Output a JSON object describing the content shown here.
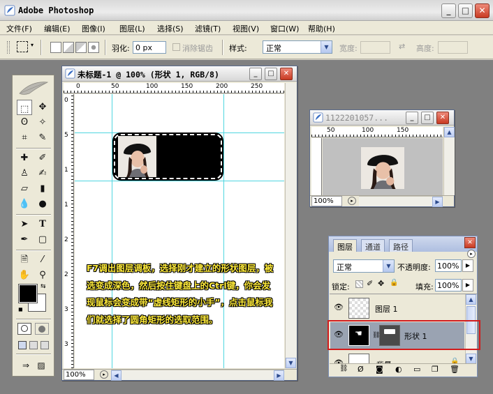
{
  "app": {
    "title": "Adobe Photoshop"
  },
  "menu": [
    "文件(F)",
    "编辑(E)",
    "图像(I)",
    "图层(L)",
    "选择(S)",
    "滤镜(T)",
    "视图(V)",
    "窗口(W)",
    "帮助(H)"
  ],
  "options": {
    "feather_label": "羽化:",
    "feather_value": "0 px",
    "antialias_label": "消除锯齿",
    "style_label": "样式:",
    "style_value": "正常",
    "width_label": "宽度:",
    "height_label": "高度:"
  },
  "doc1": {
    "title": "未标题-1 @ 100% (形状 1, RGB/8)",
    "zoom": "100%",
    "ruler_top": [
      "0",
      "50",
      "100",
      "150",
      "200",
      "250"
    ],
    "ruler_left": [
      "0",
      "5",
      "1",
      "1",
      "2",
      "2",
      "3",
      "3"
    ]
  },
  "doc2": {
    "title": "1122201057...",
    "zoom": "100%",
    "ruler_top": [
      "50",
      "100",
      "150"
    ]
  },
  "annotation": "F7调出图层调板，选择刚才建立的形状图层，被选变成深色，然后按住键盘上的Ctrl键，你会发现鼠标会变成带“虚线矩形的小手”，点击鼠标我们就选择了圆角矩形的选取范围。",
  "layers_panel": {
    "tabs": [
      "图层",
      "通道",
      "路径"
    ],
    "blend_mode": "正常",
    "opacity_label": "不透明度:",
    "opacity_value": "100%",
    "lock_label": "锁定:",
    "fill_label": "填充:",
    "fill_value": "100%",
    "layers": [
      {
        "name": "图层 1"
      },
      {
        "name": "形状 1"
      },
      {
        "name": "背景"
      }
    ]
  }
}
